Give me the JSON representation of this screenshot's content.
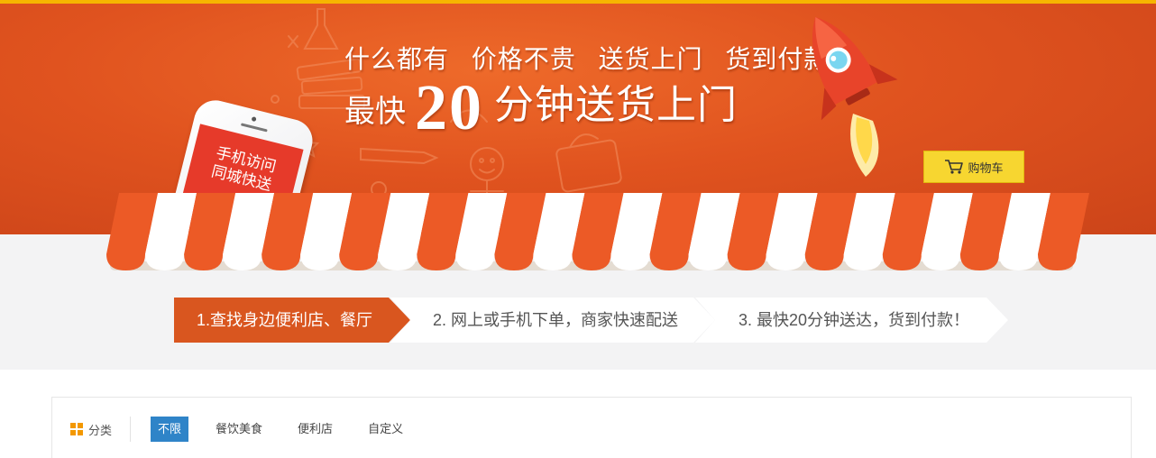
{
  "banner": {
    "headline_parts": [
      "什么都有",
      "价格不贵",
      "送货上门",
      "货到付款"
    ],
    "speed_prefix": "最快",
    "speed_number": "20",
    "speed_suffix": "分钟送货上门",
    "phone_line1": "手机访问",
    "phone_line2": "同城快送",
    "cart_label": "购物车"
  },
  "steps": [
    "1.查找身边便利店、餐厅",
    "2. 网上或手机下单，商家快速配送",
    "3. 最快20分钟送达，货到付款！"
  ],
  "filter": {
    "label": "分类",
    "options": [
      "不限",
      "餐饮美食",
      "便利店",
      "自定义"
    ],
    "selected": "不限"
  },
  "colors": {
    "banner_orange": "#e0531f",
    "awning_red": "#ec5a26",
    "accent_yellow": "#f7d630",
    "active_step": "#d9561f",
    "active_chip": "#2f84c8",
    "category_icon": [
      "#f39800",
      "#f39800",
      "#f39800",
      "#f39800"
    ]
  },
  "icons": {
    "cart": "cart-icon",
    "category": "category-grid-icon",
    "rocket": "rocket-icon",
    "phone": "phone-illustration"
  }
}
